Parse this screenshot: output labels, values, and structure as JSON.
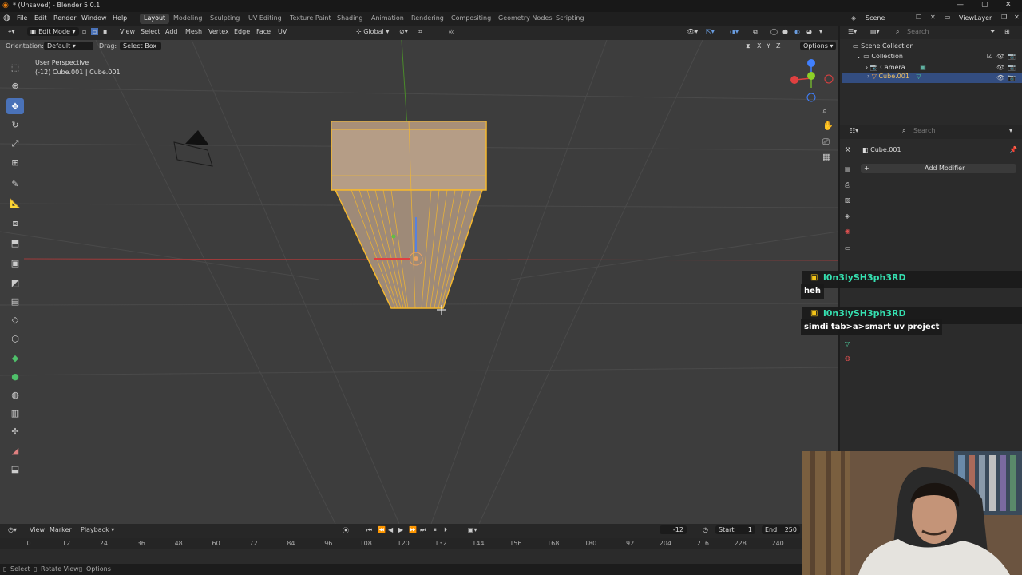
{
  "window": {
    "title": "* (Unsaved) - Blender 5.0.1"
  },
  "menu": {
    "items": [
      "File",
      "Edit",
      "Render",
      "Window",
      "Help"
    ]
  },
  "workspaces": [
    "Layout",
    "Modeling",
    "Sculpting",
    "UV Editing",
    "Texture Paint",
    "Shading",
    "Animation",
    "Rendering",
    "Compositing",
    "Geometry Nodes",
    "Scripting",
    "+"
  ],
  "scene": {
    "name": "Scene",
    "view_layer": "ViewLayer"
  },
  "header3d": {
    "mode": "Edit Mode",
    "view": "View",
    "select": "Select",
    "add": "Add",
    "mesh": "Mesh",
    "vertex": "Vertex",
    "edge": "Edge",
    "face": "Face",
    "uv": "UV",
    "transform": "Global",
    "options": "Options"
  },
  "toolopts": {
    "orientation_label": "Orientation:",
    "orientation": "Default",
    "drag_label": "Drag:",
    "drag": "Select Box",
    "axes": [
      "X",
      "Y",
      "Z"
    ]
  },
  "viewport": {
    "perspective": "User Perspective",
    "object_info": "(-12) Cube.001 | Cube.001"
  },
  "outliner": {
    "search_placeholder": "Search",
    "root": "Scene Collection",
    "collection": "Collection",
    "items": [
      "Camera",
      "Cube.001"
    ]
  },
  "properties": {
    "search_placeholder": "Search",
    "object_name": "Cube.001",
    "add_modifier": "Add Modifier"
  },
  "timeline": {
    "view": "View",
    "marker": "Marker",
    "playback": "Playback",
    "current_frame": "-12",
    "start_label": "Start",
    "start": "1",
    "end_label": "End",
    "end": "250",
    "ticks": [
      "0",
      "12",
      "24",
      "36",
      "48",
      "60",
      "72",
      "84",
      "96",
      "108",
      "120",
      "132",
      "144",
      "156",
      "168",
      "180",
      "192",
      "204",
      "216",
      "228",
      "240"
    ]
  },
  "status": {
    "select": "Select",
    "rotate": "Rotate View",
    "options": "Options"
  },
  "chat": [
    {
      "user": "l0n3lySH3ph3RD",
      "message": "heh"
    },
    {
      "user": "l0n3lySH3ph3RD",
      "message": "simdi tab>a>smart uv project"
    }
  ],
  "colors": {
    "accent": "#4a72b8",
    "selection": "#f5b82e",
    "chat_name": "#35e0b0",
    "viewport_bg": "#3d3d3d"
  }
}
